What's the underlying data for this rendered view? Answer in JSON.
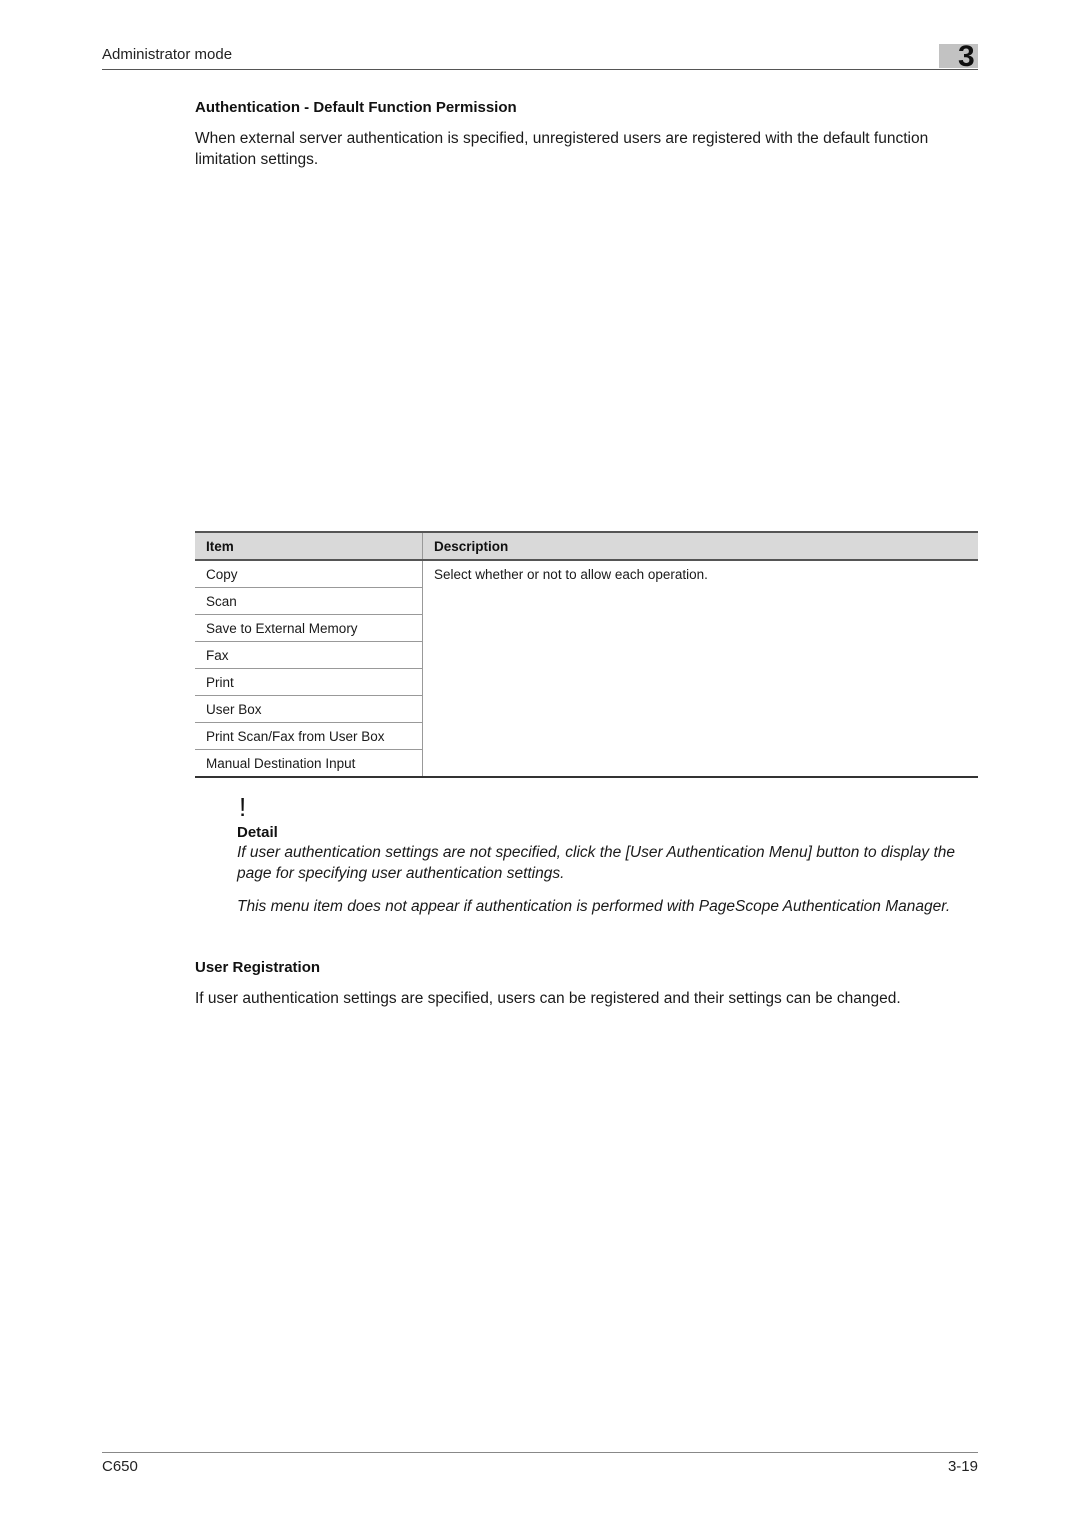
{
  "header": {
    "running_title": "Administrator mode",
    "chapter_number": "3"
  },
  "section1": {
    "heading": "Authentication - Default Function Permission",
    "paragraph": "When external server authentication is specified, unregistered users are registered with the default function limitation settings."
  },
  "table": {
    "columns": [
      "Item",
      "Description"
    ],
    "rows": [
      "Copy",
      "Scan",
      "Save to External Memory",
      "Fax",
      "Print",
      "User Box",
      "Print Scan/Fax from User Box",
      "Manual Destination Input"
    ],
    "description": "Select whether or not to allow each operation."
  },
  "note": {
    "icon": "!",
    "icon_name": "exclamation-icon",
    "title": "Detail",
    "paragraphs": [
      "If user authentication settings are not specified, click the [User Authentication Menu] button to display the page for specifying user authentication settings.",
      "This menu item does not appear if authentication is performed with PageScope Authentication Manager."
    ]
  },
  "section2": {
    "heading": "User Registration",
    "paragraph": "If user authentication settings are specified, users can be registered and their settings can be changed."
  },
  "footer": {
    "model": "C650",
    "page_number": "3-19"
  }
}
